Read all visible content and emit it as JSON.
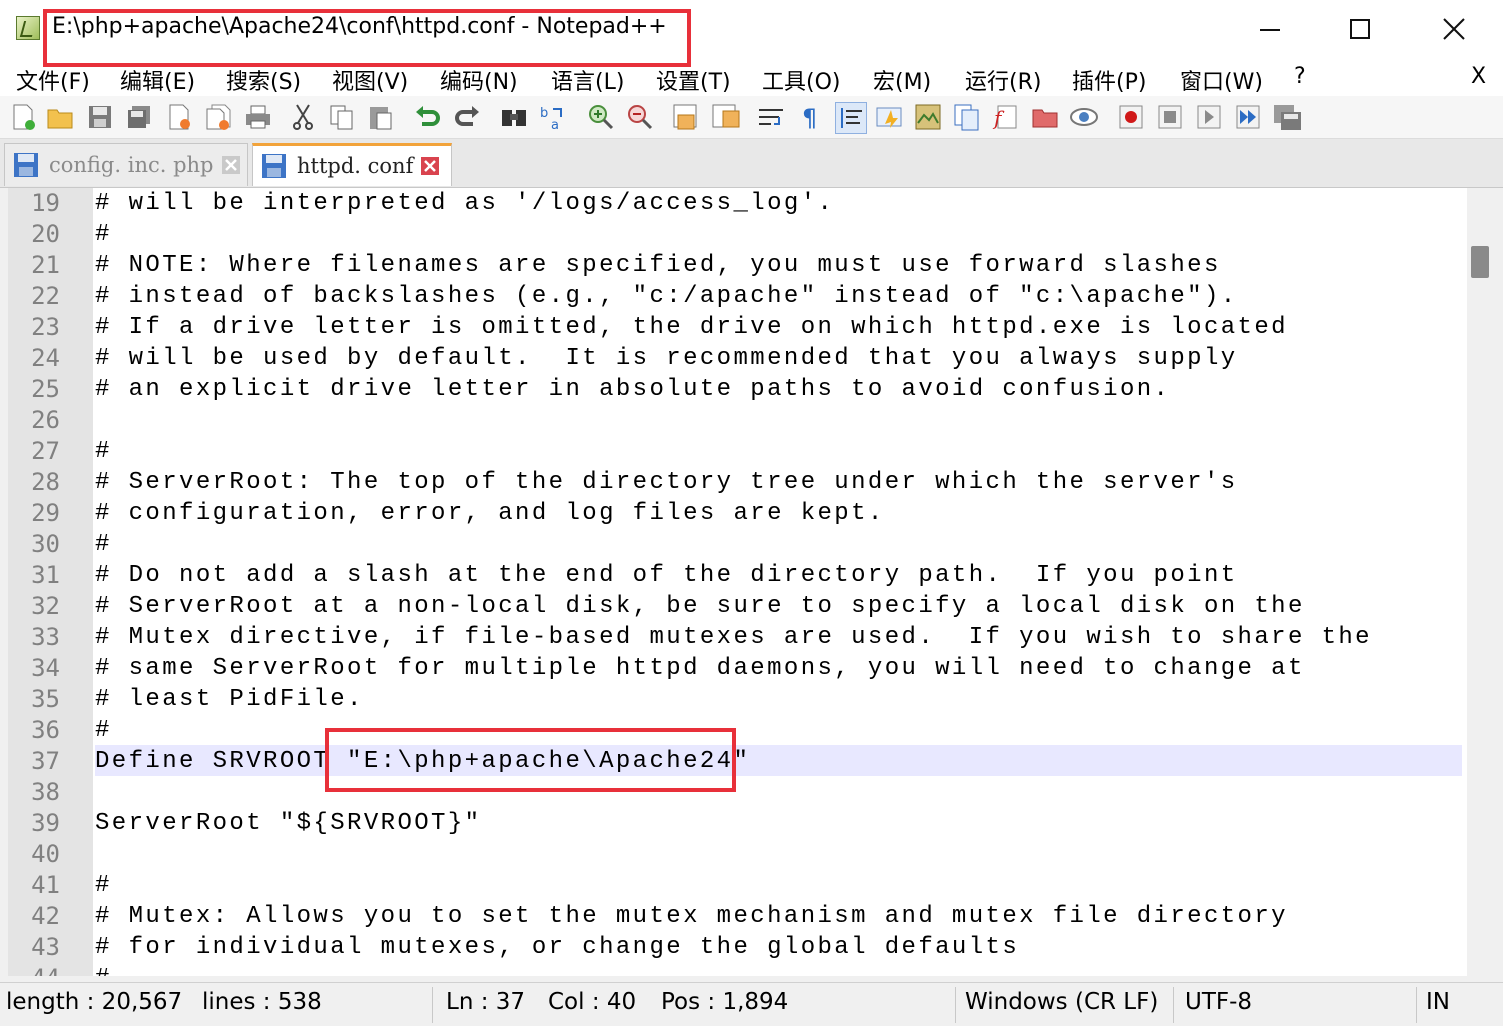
{
  "window": {
    "title": "E:\\php+apache\\Apache24\\conf\\httpd.conf - Notepad++",
    "minimize_glyph": "—",
    "maximize_glyph": "☐",
    "close_glyph": "✕"
  },
  "menu": {
    "items": [
      "文件(F)",
      "编辑(E)",
      "搜索(S)",
      "视图(V)",
      "编码(N)",
      "语言(L)",
      "设置(T)",
      "工具(O)",
      "宏(M)",
      "运行(R)",
      "插件(P)",
      "窗口(W)",
      "?"
    ],
    "close_label": "X"
  },
  "toolbar": {
    "icons": [
      "new-file-icon",
      "open-file-icon",
      "save-icon",
      "save-all-icon",
      "close-file-icon",
      "close-all-icon",
      "print-icon",
      "cut-icon",
      "copy-icon",
      "paste-icon",
      "undo-icon",
      "redo-icon",
      "find-icon",
      "replace-icon",
      "zoom-in-icon",
      "zoom-out-icon",
      "sync-vertical-icon",
      "sync-horizontal-icon",
      "word-wrap-icon",
      "show-all-chars-icon",
      "indent-guide-icon",
      "udl-icon",
      "doc-map-icon",
      "doc-list-icon",
      "function-list-icon",
      "folder-workspace-icon",
      "monitoring-icon",
      "record-macro-icon",
      "stop-macro-icon",
      "play-macro-icon",
      "run-macro-multiple-icon",
      "save-macro-icon"
    ]
  },
  "tabs": [
    {
      "label": "config. inc. php",
      "active": false
    },
    {
      "label": "httpd. conf",
      "active": true
    }
  ],
  "editor": {
    "lines": [
      {
        "n": "19",
        "text": "# will be interpreted as '/logs/access_log'."
      },
      {
        "n": "20",
        "text": "#"
      },
      {
        "n": "21",
        "text": "# NOTE: Where filenames are specified, you must use forward slashes"
      },
      {
        "n": "22",
        "text": "# instead of backslashes (e.g., \"c:/apache\" instead of \"c:\\apache\")."
      },
      {
        "n": "23",
        "text": "# If a drive letter is omitted, the drive on which httpd.exe is located"
      },
      {
        "n": "24",
        "text": "# will be used by default.  It is recommended that you always supply"
      },
      {
        "n": "25",
        "text": "# an explicit drive letter in absolute paths to avoid confusion."
      },
      {
        "n": "26",
        "text": ""
      },
      {
        "n": "27",
        "text": "#"
      },
      {
        "n": "28",
        "text": "# ServerRoot: The top of the directory tree under which the server's"
      },
      {
        "n": "29",
        "text": "# configuration, error, and log files are kept."
      },
      {
        "n": "30",
        "text": "#"
      },
      {
        "n": "31",
        "text": "# Do not add a slash at the end of the directory path.  If you point"
      },
      {
        "n": "32",
        "text": "# ServerRoot at a non-local disk, be sure to specify a local disk on the"
      },
      {
        "n": "33",
        "text": "# Mutex directive, if file-based mutexes are used.  If you wish to share the"
      },
      {
        "n": "34",
        "text": "# same ServerRoot for multiple httpd daemons, you will need to change at"
      },
      {
        "n": "35",
        "text": "# least PidFile."
      },
      {
        "n": "36",
        "text": "#"
      },
      {
        "n": "37",
        "text": "Define SRVROOT \"E:\\php+apache\\Apache24\""
      },
      {
        "n": "38",
        "text": ""
      },
      {
        "n": "39",
        "text": "ServerRoot \"${SRVROOT}\""
      },
      {
        "n": "40",
        "text": ""
      },
      {
        "n": "41",
        "text": "#"
      },
      {
        "n": "42",
        "text": "# Mutex: Allows you to set the mutex mechanism and mutex file directory"
      },
      {
        "n": "43",
        "text": "# for individual mutexes, or change the global defaults"
      },
      {
        "n": "44",
        "text": "#"
      }
    ]
  },
  "status": {
    "length": "length : 20,567",
    "lines": "lines : 538",
    "ln": "Ln : 37",
    "col": "Col : 40",
    "pos": "Pos : 1,894",
    "eol": "Windows (CR LF)",
    "encoding": "UTF-8",
    "mode": "IN"
  },
  "colors": {
    "highlight_box": "#e8303a",
    "current_line": "#e8e8ff",
    "tab_accent": "#f2a33a"
  }
}
